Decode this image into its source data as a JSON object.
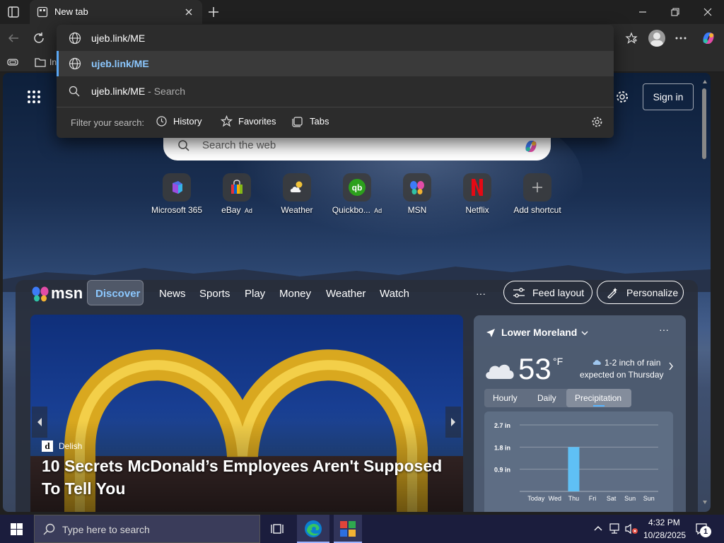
{
  "tab": {
    "title": "New tab"
  },
  "address": {
    "value": "ujeb.link/ME"
  },
  "favorites_bar": {
    "first_item_label": "In"
  },
  "suggestions": {
    "selected": "ujeb.link/ME",
    "search_query": "ujeb.link/ME",
    "search_suffix": " - Search",
    "filter_label": "Filter your search:",
    "filters": [
      "History",
      "Favorites",
      "Tabs"
    ]
  },
  "page": {
    "sign_in": "Sign in",
    "search_placeholder": "Search the web",
    "shortcuts": [
      {
        "label": "Microsoft 365",
        "ad": ""
      },
      {
        "label": "eBay",
        "ad": "Ad"
      },
      {
        "label": "Weather",
        "ad": ""
      },
      {
        "label": "Quickbo...",
        "ad": "Ad"
      },
      {
        "label": "MSN",
        "ad": ""
      },
      {
        "label": "Netflix",
        "ad": ""
      },
      {
        "label": "Add shortcut",
        "ad": ""
      }
    ]
  },
  "msn": {
    "logo": "msn",
    "nav": [
      "Discover",
      "News",
      "Sports",
      "Play",
      "Money",
      "Weather",
      "Watch"
    ],
    "more": "···",
    "feed_layout": "Feed layout",
    "personalize": "Personalize",
    "story": {
      "source": "Delish",
      "headline": "10 Secrets McDonald’s Employees Aren't Supposed To Tell You"
    }
  },
  "weather": {
    "location": "Lower Moreland",
    "temp": "53",
    "unit": "°F",
    "note_line1": "1-2 inch of rain",
    "note_line2": "expected on Thursday",
    "tabs": [
      "Hourly",
      "Daily",
      "Precipitation"
    ],
    "active_tab": "Precipitation"
  },
  "chart_data": {
    "type": "bar",
    "categories": [
      "Today",
      "Wed",
      "Thu",
      "Fri",
      "Sat",
      "Sun",
      "Sun"
    ],
    "values": [
      0,
      0,
      1.8,
      0,
      0,
      0,
      0
    ],
    "y_ticks": [
      "2.7 in",
      "1.8 in",
      "0.9 in"
    ],
    "ylim": [
      0,
      2.7
    ]
  },
  "taskbar": {
    "search_placeholder": "Type here to search",
    "time": "4:32 PM",
    "date": "10/28/2025",
    "notification_count": "1"
  }
}
